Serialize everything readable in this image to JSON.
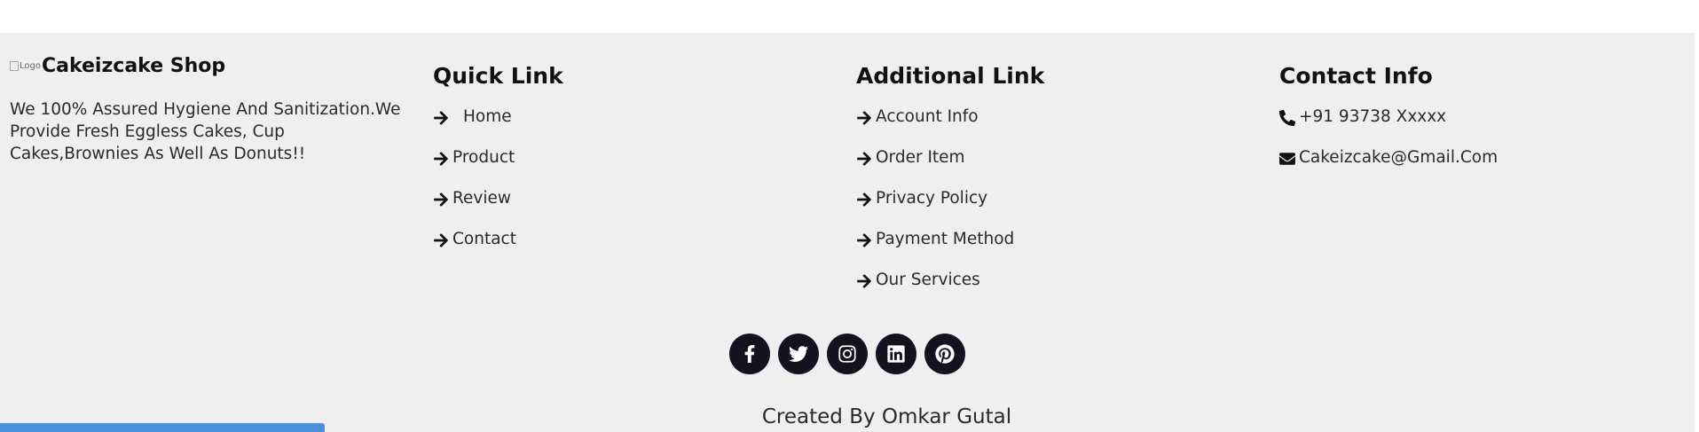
{
  "brand": {
    "logo_alt": "Logo",
    "name": "Cakeizcake Shop",
    "description": "We 100% Assured Hygiene And Sanitization.We Provide Fresh Eggless Cakes, Cup Cakes,Brownies As Well As Donuts!!"
  },
  "quick_links": {
    "title": "Quick Link",
    "items": [
      {
        "label": "Home",
        "icon": "arrow-right-icon"
      },
      {
        "label": "Product",
        "icon": "arrow-right-icon"
      },
      {
        "label": "Review",
        "icon": "arrow-right-icon"
      },
      {
        "label": "Contact",
        "icon": "arrow-right-icon"
      }
    ]
  },
  "additional_links": {
    "title": "Additional Link",
    "items": [
      {
        "label": "Account Info",
        "icon": "arrow-right-icon"
      },
      {
        "label": "Order Item",
        "icon": "arrow-right-icon"
      },
      {
        "label": "Privacy Policy",
        "icon": "arrow-right-icon"
      },
      {
        "label": "Payment Method",
        "icon": "arrow-right-icon"
      },
      {
        "label": "Our Services",
        "icon": "arrow-right-icon"
      }
    ]
  },
  "contact": {
    "title": "Contact Info",
    "phone": "+91 93738 Xxxxx",
    "email": "Cakeizcake@Gmail.Com"
  },
  "social": [
    "facebook-icon",
    "twitter-icon",
    "instagram-icon",
    "linkedin-icon",
    "pinterest-icon"
  ],
  "credit": "Created By Omkar Gutal",
  "colors": {
    "footer_bg": "#efefef",
    "social_bg": "#15111f",
    "status_bar": "#4a8fd9"
  }
}
